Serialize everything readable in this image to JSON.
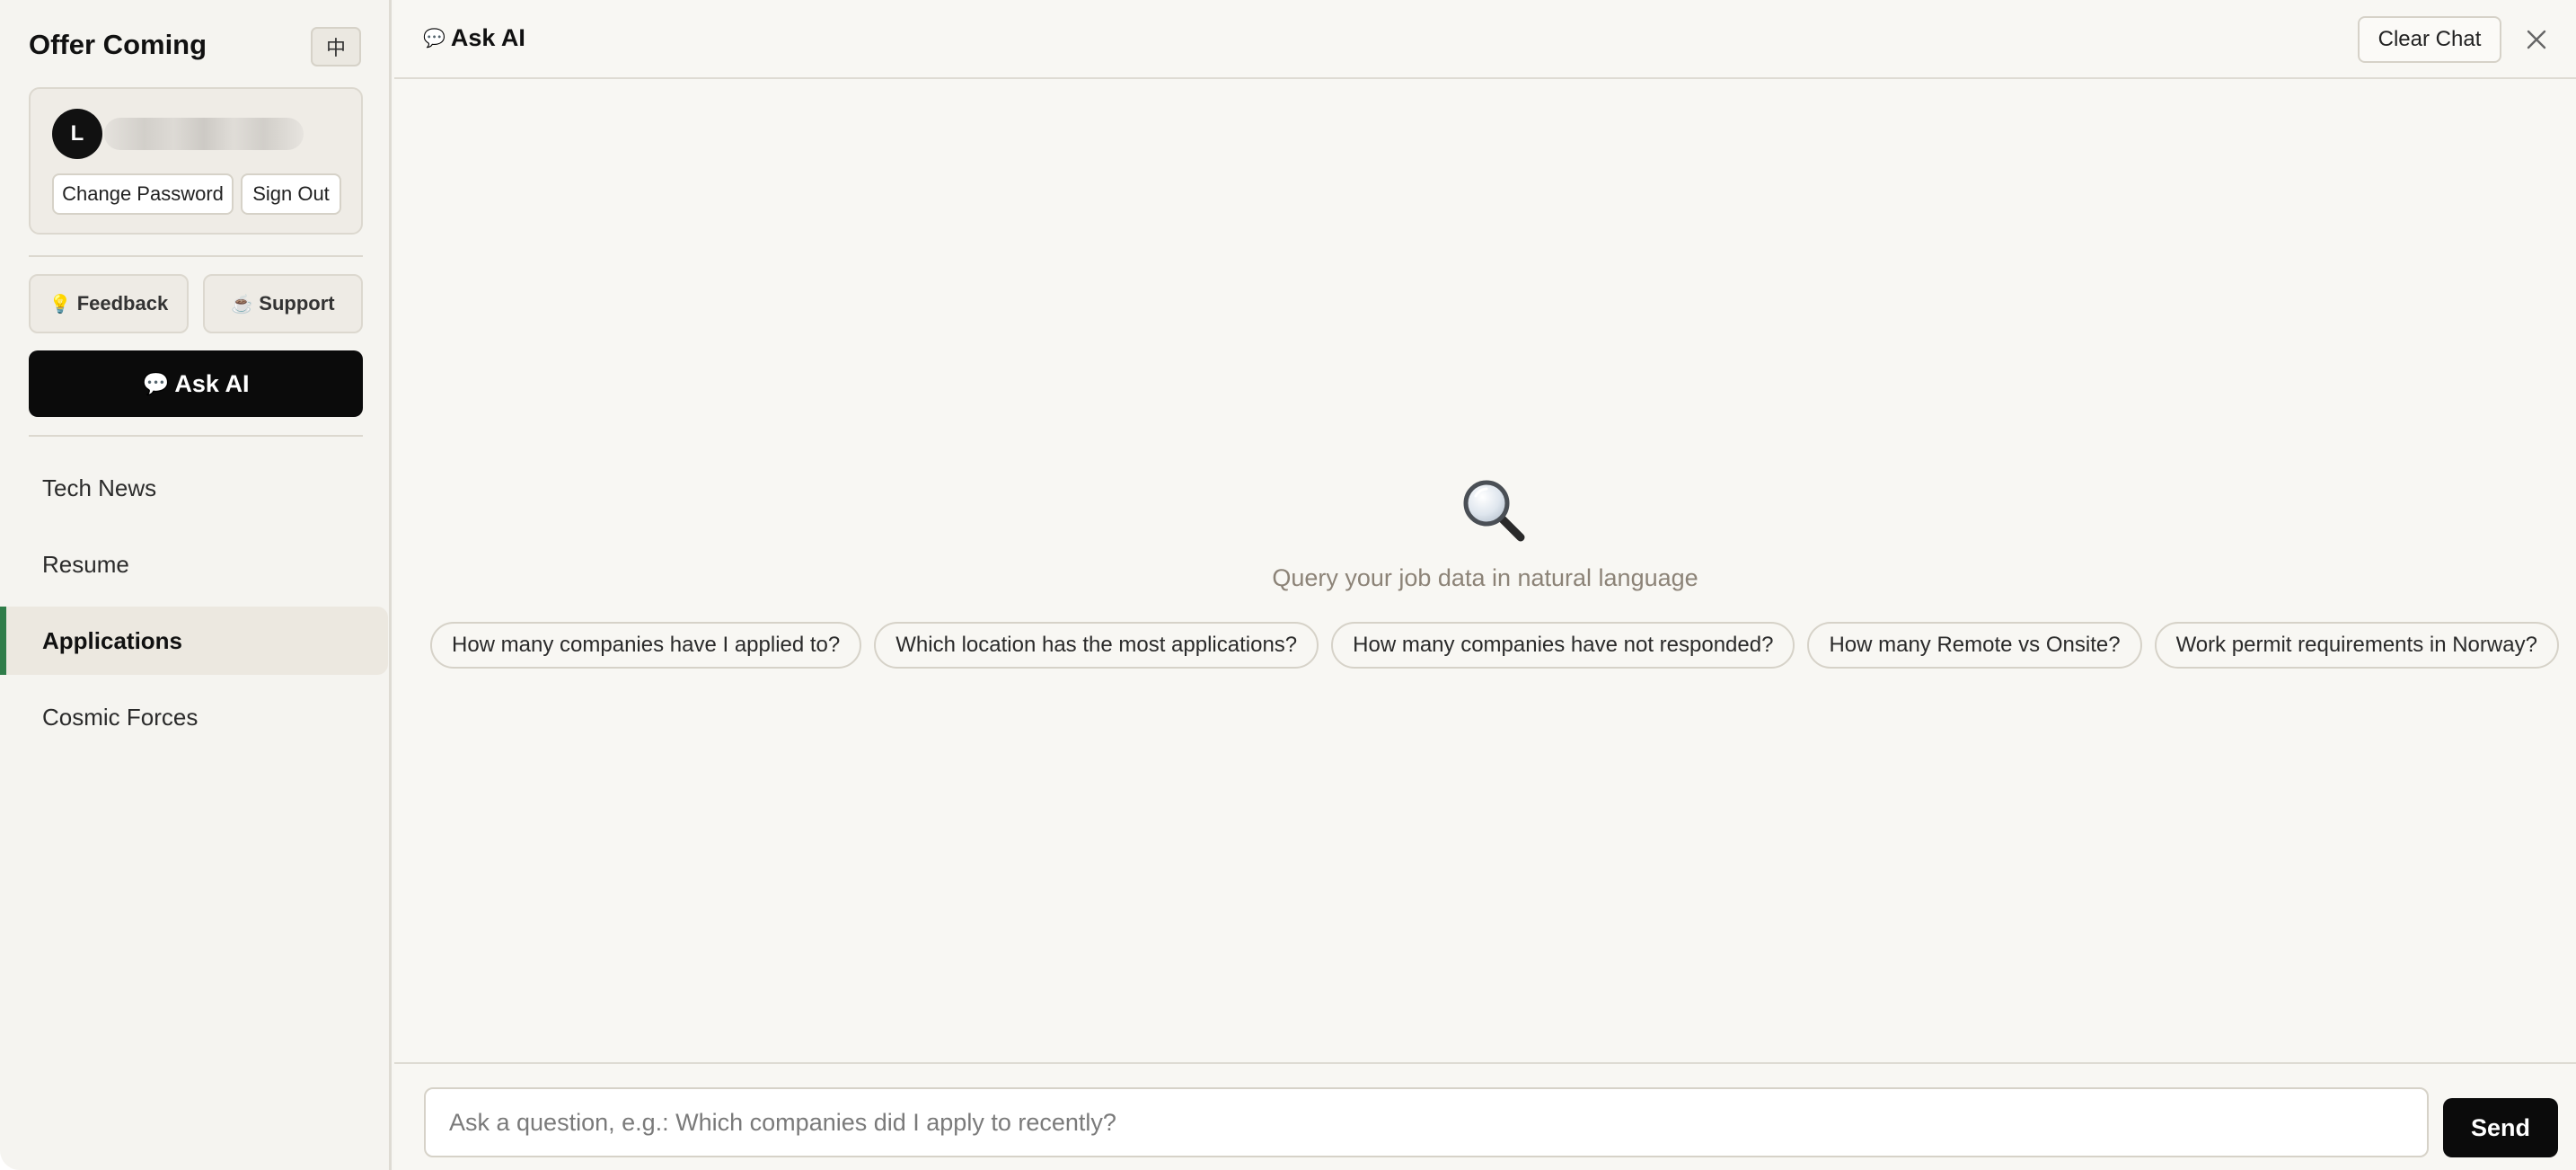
{
  "sidebar": {
    "brand": "Offer Coming",
    "lang_toggle": "中",
    "user": {
      "avatar_initial": "L",
      "change_password": "Change Password",
      "sign_out": "Sign Out"
    },
    "feedback": {
      "icon": "💡",
      "label": "Feedback"
    },
    "support": {
      "icon": "☕",
      "label": "Support"
    },
    "ask_ai": {
      "icon": "💬",
      "label": "Ask AI"
    },
    "nav": [
      {
        "label": "Tech News",
        "active": false
      },
      {
        "label": "Resume",
        "active": false
      },
      {
        "label": "Applications",
        "active": true
      },
      {
        "label": "Cosmic Forces",
        "active": false
      }
    ],
    "active_accent": "#2f7d4a"
  },
  "panel": {
    "title_icon": "💬",
    "title": "Ask AI",
    "clear_chat": "Clear Chat",
    "close_icon": "close-icon",
    "empty_icon": "magnifier-icon",
    "empty_text": "Query your job data in natural language",
    "suggestions": [
      "How many companies have I applied to?",
      "Which location has the most applications?",
      "How many companies have not responded?",
      "How many Remote vs Onsite?",
      "Work permit requirements in Norway?"
    ],
    "input": {
      "value": "",
      "placeholder": "Ask a question, e.g.: Which companies did I apply to recently?"
    },
    "send": "Send"
  }
}
